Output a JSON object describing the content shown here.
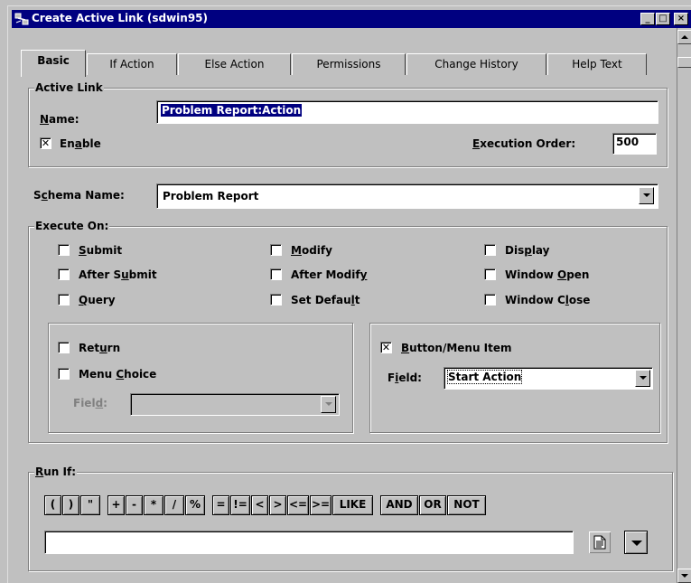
{
  "window": {
    "title": "Create Active Link (sdwin95)",
    "controls": {
      "minimize": "_",
      "maximize": "□",
      "close": "×"
    }
  },
  "tabs": [
    "Basic",
    "If Action",
    "Else Action",
    "Permissions",
    "Change History",
    "Help Text"
  ],
  "active_link": {
    "group_label": "Active Link",
    "name_label": "Name:",
    "name_value": "Problem Report:Action",
    "enable_label": "Enable",
    "enable_checked": true,
    "exec_order_label": "Execution Order:",
    "exec_order_value": "500"
  },
  "schema": {
    "label": "Schema Name:",
    "value": "Problem Report"
  },
  "execute_on": {
    "group_label": "Execute On:",
    "options": [
      {
        "label": "Submit",
        "checked": false
      },
      {
        "label": "Modify",
        "checked": false
      },
      {
        "label": "Display",
        "checked": false
      },
      {
        "label": "After Submit",
        "checked": false
      },
      {
        "label": "After Modify",
        "checked": false
      },
      {
        "label": "Window Open",
        "checked": false
      },
      {
        "label": "Query",
        "checked": false
      },
      {
        "label": "Set Default",
        "checked": false
      },
      {
        "label": "Window Close",
        "checked": false
      }
    ],
    "return_label": "Return",
    "menu_choice_label": "Menu Choice",
    "menu_field_label": "Field:",
    "menu_field_value": "",
    "button_menu_label": "Button/Menu Item",
    "button_menu_checked": true,
    "button_field_label": "Field:",
    "button_field_value": "Start Action"
  },
  "run_if": {
    "group_label": "Run If:",
    "operators": [
      "(",
      ")",
      "\"",
      "+",
      "-",
      "*",
      "/",
      "%",
      "=",
      "!=",
      "<",
      ">",
      "<=",
      ">=",
      "LIKE",
      "AND",
      "OR",
      "NOT"
    ],
    "qualification": ""
  },
  "icons": {
    "app": "active-link-icon",
    "editor": "document-icon",
    "more": "chevron-down-icon"
  }
}
